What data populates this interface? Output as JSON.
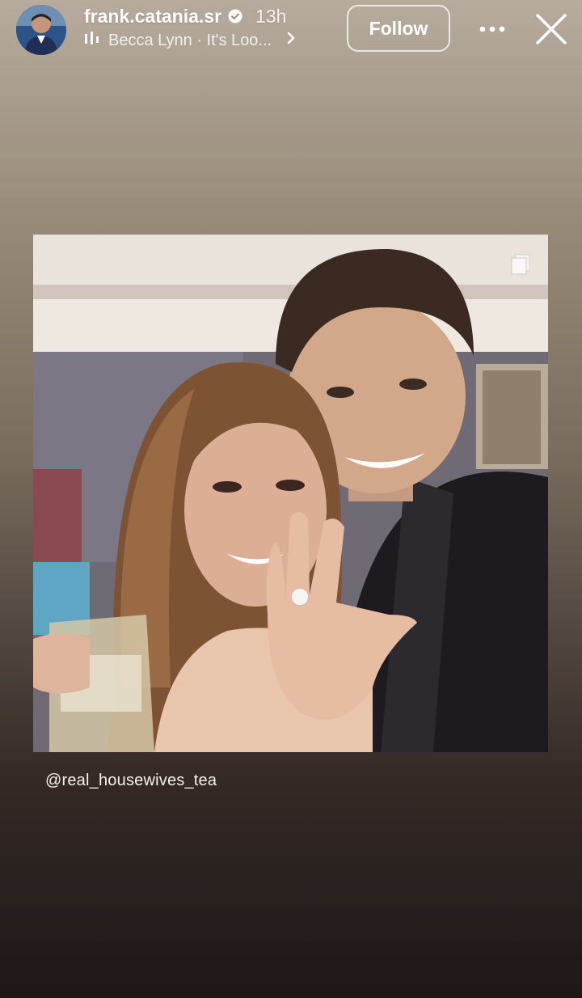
{
  "header": {
    "username": "frank.catania.sr",
    "time": "13h",
    "music": "Becca Lynn · It's Loo...",
    "follow_label": "Follow"
  },
  "icons": {
    "verified": "verified-badge-icon",
    "music": "music-bars-icon",
    "more": "more-dots-icon",
    "close": "close-icon",
    "chevron": "chevron-right-icon"
  },
  "post": {
    "mention": "@real_housewives_tea"
  },
  "colors": {
    "background_top": "#b6ab9d",
    "background_bottom": "#1d1715",
    "text": "#ffffff"
  }
}
